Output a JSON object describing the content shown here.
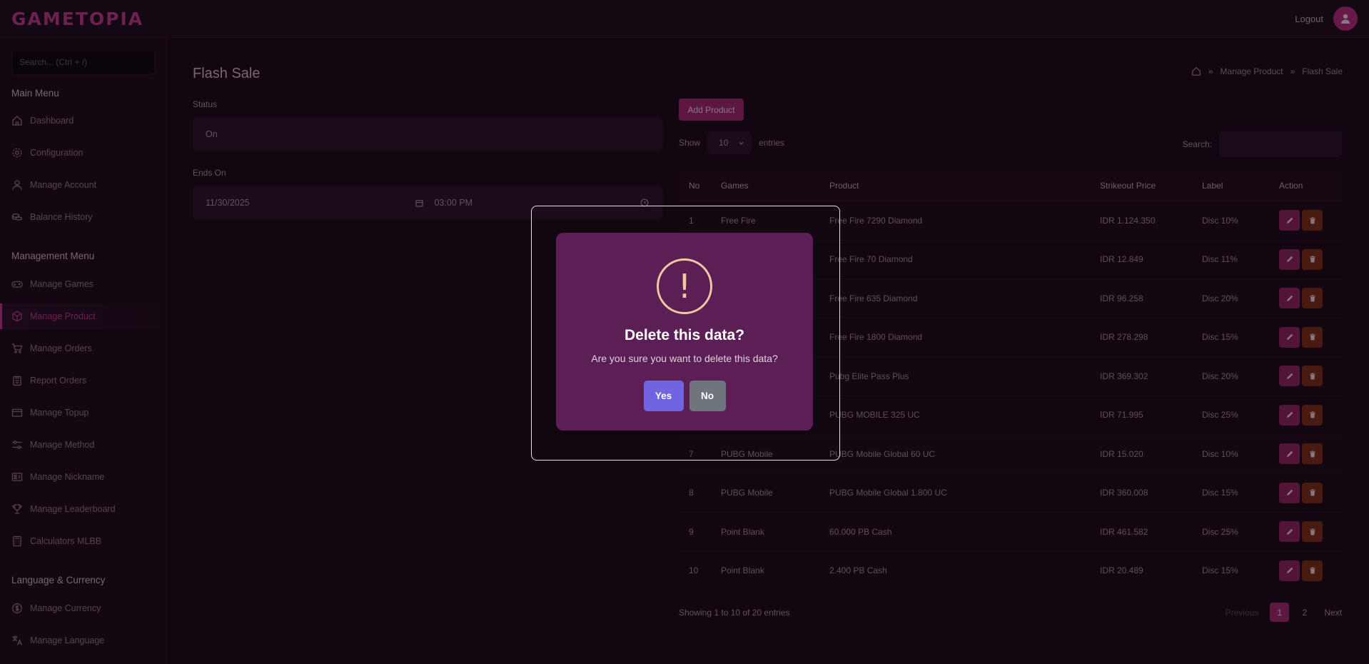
{
  "brand": {
    "logo": "GAMETOPIA",
    "accent": "#c23a8c"
  },
  "header": {
    "logout_label": "Logout",
    "avatar_icon": "user-icon"
  },
  "sidebar": {
    "search_placeholder": "Search... (Ctrl + /)",
    "sections": [
      {
        "heading": "Main Menu",
        "items": [
          {
            "label": "Dashboard",
            "icon": "home-icon"
          },
          {
            "label": "Configuration",
            "icon": "gear-icon"
          },
          {
            "label": "Manage Account",
            "icon": "user-icon"
          },
          {
            "label": "Balance History",
            "icon": "coins-icon"
          }
        ]
      },
      {
        "heading": "Management Menu",
        "items": [
          {
            "label": "Manage Games",
            "icon": "gamepad-icon"
          },
          {
            "label": "Manage Product",
            "icon": "box-icon",
            "active": true
          },
          {
            "label": "Manage Orders",
            "icon": "cart-icon"
          },
          {
            "label": "Report Orders",
            "icon": "clipboard-icon"
          },
          {
            "label": "Manage Topup",
            "icon": "wallet-icon"
          },
          {
            "label": "Manage Method",
            "icon": "sliders-icon"
          },
          {
            "label": "Manage Nickname",
            "icon": "id-card-icon"
          },
          {
            "label": "Manage Leaderboard",
            "icon": "trophy-icon"
          },
          {
            "label": "Calculators MLBB",
            "icon": "calculator-icon"
          }
        ]
      },
      {
        "heading": "Language & Currency",
        "items": [
          {
            "label": "Manage Currency",
            "icon": "dollar-circle-icon"
          },
          {
            "label": "Manage Language",
            "icon": "translate-icon"
          }
        ]
      }
    ]
  },
  "page": {
    "title": "Flash Sale",
    "breadcrumb": [
      "Manage Product",
      "Flash Sale"
    ],
    "status_label": "Status",
    "status_value": "On",
    "ends_on_label": "Ends On",
    "ends_on_date": "11/30/2025",
    "ends_on_time": "03:00 PM",
    "add_button": "Add Product",
    "show_label": "Show",
    "entries_value": "10",
    "entries_label": "entries",
    "search_label": "Search:"
  },
  "table": {
    "headers": [
      "No",
      "Games",
      "Product",
      "Strikeout Price",
      "Label",
      "Action"
    ],
    "rows": [
      {
        "no": "1",
        "game": "Free Fire",
        "product": "Free Fire 7290 Diamond",
        "price": "IDR 1.124.350",
        "label": "Disc 10%"
      },
      {
        "no": "2",
        "game": "",
        "product": "Free Fire 70 Diamond",
        "price": "IDR 12.849",
        "label": "Disc 11%"
      },
      {
        "no": "3",
        "game": "",
        "product": "Free Fire 635 Diamond",
        "price": "IDR 96.258",
        "label": "Disc 20%"
      },
      {
        "no": "4",
        "game": "",
        "product": "Free Fire 1800 Diamond",
        "price": "IDR 278.298",
        "label": "Disc 15%"
      },
      {
        "no": "5",
        "game": "",
        "product": "Pubg Elite Pass Plus",
        "price": "IDR 369.302",
        "label": "Disc 20%"
      },
      {
        "no": "6",
        "game": "",
        "product": "PUBG MOBILE 325 UC",
        "price": "IDR 71.995",
        "label": "Disc 25%"
      },
      {
        "no": "7",
        "game": "PUBG Mobile",
        "product": "PUBG Mobile Global 60 UC",
        "price": "IDR 15.020",
        "label": "Disc 10%"
      },
      {
        "no": "8",
        "game": "PUBG Mobile",
        "product": "PUBG Mobile Global 1.800 UC",
        "price": "IDR 360.008",
        "label": "Disc 15%"
      },
      {
        "no": "9",
        "game": "Point Blank",
        "product": "60.000 PB Cash",
        "price": "IDR 461.582",
        "label": "Disc 25%"
      },
      {
        "no": "10",
        "game": "Point Blank",
        "product": "2.400 PB Cash",
        "price": "IDR 20.489",
        "label": "Disc 15%"
      }
    ],
    "showing": "Showing 1 to 10 of 20 entries",
    "pager": {
      "prev": "Previous",
      "pages": [
        "1",
        "2"
      ],
      "current": "1",
      "next": "Next"
    }
  },
  "modal": {
    "icon": "exclamation-icon",
    "icon_glyph": "!",
    "title": "Delete this data?",
    "text": "Are you sure you want to delete this data?",
    "yes": "Yes",
    "no": "No"
  }
}
